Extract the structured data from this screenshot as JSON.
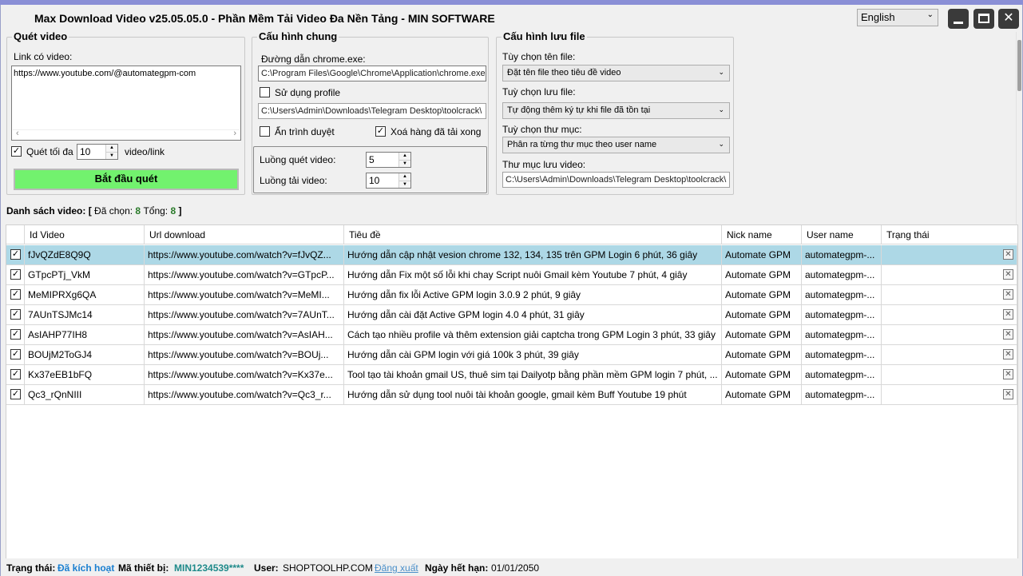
{
  "window": {
    "title": "Max Download Video v25.05.05.0 -  Phần Mềm Tải Video Đa Nền Tảng - MIN SOFTWARE",
    "language": "English"
  },
  "scan": {
    "title": "Quét video",
    "link_label": "Link có video:",
    "link_value": "https://www.youtube.com/@automategpm-com",
    "max_label": "Quét tối đa",
    "max_value": "10",
    "max_unit": "video/link",
    "start_button": "Bắt đầu quét"
  },
  "general": {
    "title": "Cấu hình chung",
    "chrome_label": "Đường dẫn chrome.exe:",
    "chrome_path": "C:\\Program Files\\Google\\Chrome\\Application\\chrome.exe",
    "use_profile_label": "Sử dụng profile",
    "profile_path": "C:\\Users\\Admin\\Downloads\\Telegram Desktop\\toolcrack\\",
    "hide_browser_label": "Ẩn trình duyệt",
    "delete_row_label": "Xoá hàng đã tải xong",
    "scan_threads_label": "Luồng quét video:",
    "scan_threads_value": "5",
    "download_threads_label": "Luồng tải video:",
    "download_threads_value": "10"
  },
  "save": {
    "title": "Cấu hình lưu file",
    "filename_label": "Tùy chọn tên file:",
    "filename_value": "Đặt tên file theo tiêu đề video",
    "save_option_label": "Tuỳ chọn lưu file:",
    "save_option_value": "Tự động thêm ký tự khi file đã tồn tại",
    "folder_option_label": "Tuỳ chọn thư mục:",
    "folder_option_value": "Phân ra từng thư mục theo user name",
    "folder_label": "Thư mục lưu video:",
    "folder_value": "C:\\Users\\Admin\\Downloads\\Telegram Desktop\\toolcrack\\"
  },
  "list": {
    "label": "Danh sách video:",
    "open": "[",
    "selected_label": "Đã chọn:",
    "selected": "8",
    "total_label": "Tổng:",
    "total": "8",
    "close": "]",
    "columns": [
      "Id Video",
      "Url download",
      "Tiêu đề",
      "Nick name",
      "User name",
      "Trạng thái"
    ],
    "rows": [
      {
        "id": "fJvQZdE8Q9Q",
        "url": "https://www.youtube.com/watch?v=fJvQZ...",
        "title": "Hướng dẫn cập nhật vesion chrome 132, 134, 135 trên GPM Login 6 phút, 36 giây",
        "nick": "Automate GPM",
        "user": "automategpm-...",
        "status": ""
      },
      {
        "id": "GTpcPTj_VkM",
        "url": "https://www.youtube.com/watch?v=GTpcP...",
        "title": "Hướng dẫn Fix một số lỗi khi chay Script nuôi Gmail kèm Youtube 7 phút, 4 giây",
        "nick": "Automate GPM",
        "user": "automategpm-...",
        "status": ""
      },
      {
        "id": "MeMIPRXg6QA",
        "url": "https://www.youtube.com/watch?v=MeMI...",
        "title": "Hướng dẫn fix lỗi Active GPM login 3.0.9 2 phút, 9 giây",
        "nick": "Automate GPM",
        "user": "automategpm-...",
        "status": ""
      },
      {
        "id": "7AUnTSJMc14",
        "url": "https://www.youtube.com/watch?v=7AUnT...",
        "title": "Hướng dẫn cài đặt Active GPM login 4.0 4 phút, 31 giây",
        "nick": "Automate GPM",
        "user": "automategpm-...",
        "status": ""
      },
      {
        "id": "AsIAHP77IH8",
        "url": "https://www.youtube.com/watch?v=AsIAH...",
        "title": "Cách tạo nhiều profile và thêm extension giải captcha trong GPM Login 3 phút, 33 giây",
        "nick": "Automate GPM",
        "user": "automategpm-...",
        "status": ""
      },
      {
        "id": "BOUjM2ToGJ4",
        "url": "https://www.youtube.com/watch?v=BOUj...",
        "title": "Hướng dẫn cài GPM login với giá 100k 3 phút, 39 giây",
        "nick": "Automate GPM",
        "user": "automategpm-...",
        "status": ""
      },
      {
        "id": "Kx37eEB1bFQ",
        "url": "https://www.youtube.com/watch?v=Kx37e...",
        "title": "Tool tạo tài khoản gmail US, thuê sim tại Dailyotp bằng phần mềm GPM login 7 phút, ...",
        "nick": "Automate GPM",
        "user": "automategpm-...",
        "status": ""
      },
      {
        "id": "Qc3_rQnNIII",
        "url": "https://www.youtube.com/watch?v=Qc3_r...",
        "title": "Hướng dẫn sử dụng tool nuôi tài khoản google, gmail kèm Buff Youtube 19 phút",
        "nick": "Automate GPM",
        "user": "automategpm-...",
        "status": ""
      }
    ]
  },
  "status": {
    "status_label": "Trạng thái:",
    "status_value": "Đã kích hoạt",
    "device_label": "Mã thiết bị:",
    "device_value": "MIN1234539****",
    "user_label": "User:",
    "user_value": "SHOPTOOLHP.COM",
    "logout": "Đăng xuất",
    "expiry_label": "Ngày hết hạn:",
    "expiry_value": "01/01/2050"
  }
}
